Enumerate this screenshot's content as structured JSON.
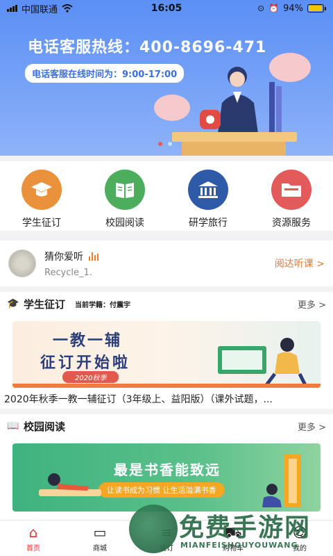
{
  "status_bar": {
    "carrier": "中国联通",
    "time": "16:05",
    "battery": "94%",
    "battery_level": 0.94
  },
  "banner": {
    "hotline": "电话客服热线：400-8696-471",
    "hours": "电话客服在线时间为：9:00-17:00",
    "slide_count": 2,
    "active_slide": 1
  },
  "menu": [
    {
      "label": "学生征订",
      "icon": "graduation-cap-icon",
      "color": "#e9923b"
    },
    {
      "label": "校园阅读",
      "icon": "book-icon",
      "color": "#4cae5c"
    },
    {
      "label": "研学旅行",
      "icon": "museum-icon",
      "color": "#2f5aa8"
    },
    {
      "label": "资源服务",
      "icon": "folder-icon",
      "color": "#e25a5a"
    }
  ],
  "audio": {
    "title": "猜你爱听",
    "subtitle": "Recycle_1.",
    "action": "阅达听课 >"
  },
  "section_order": {
    "title": "学生征订",
    "extra": "当前学籍：付震宇",
    "more": "更多 >"
  },
  "order_banner": {
    "line1": "一教一辅",
    "line2": "征订开始啦",
    "badge": "2020秋季"
  },
  "order_caption": "2020年秋季一教一辅征订（3年级上、益阳版）（课外试题，...",
  "section_reading": {
    "title": "校园阅读",
    "more": "更多 >"
  },
  "reading_banner": {
    "line1": "最是书香能致远",
    "line2": "让读书成为习惯 让生活溢满书香"
  },
  "tabs": [
    {
      "label": "首页",
      "icon": "home-icon",
      "active": true
    },
    {
      "label": "商城",
      "icon": "shopping-bag-icon",
      "active": false
    },
    {
      "label": "征订",
      "icon": "order-icon",
      "active": false
    },
    {
      "label": "购物车",
      "icon": "cart-icon",
      "active": false
    },
    {
      "label": "我的",
      "icon": "user-icon",
      "active": false
    }
  ],
  "watermark": {
    "text": "免费手游网",
    "sub": "MIANFEISHOUYOUWANG"
  }
}
